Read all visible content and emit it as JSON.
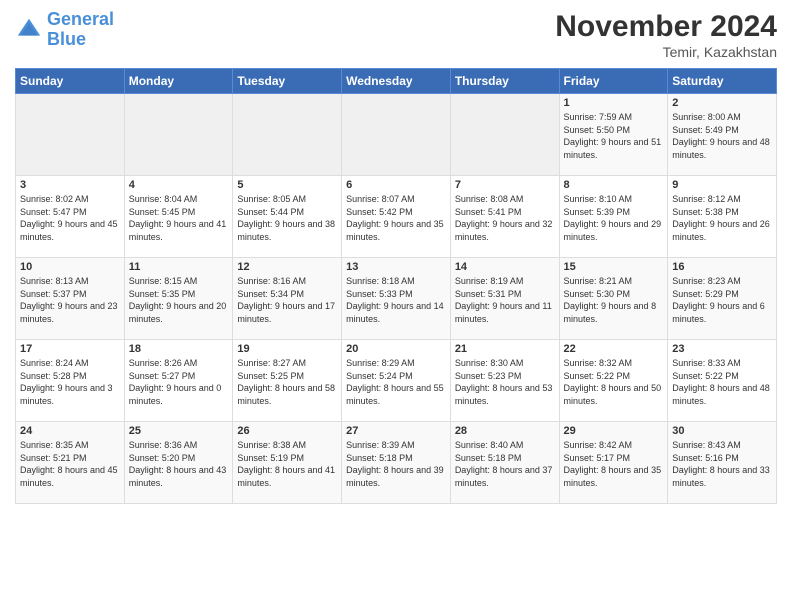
{
  "header": {
    "logo_line1": "General",
    "logo_line2": "Blue",
    "main_title": "November 2024",
    "subtitle": "Temir, Kazakhstan"
  },
  "days_of_week": [
    "Sunday",
    "Monday",
    "Tuesday",
    "Wednesday",
    "Thursday",
    "Friday",
    "Saturday"
  ],
  "weeks": [
    [
      {
        "day": "",
        "info": ""
      },
      {
        "day": "",
        "info": ""
      },
      {
        "day": "",
        "info": ""
      },
      {
        "day": "",
        "info": ""
      },
      {
        "day": "",
        "info": ""
      },
      {
        "day": "1",
        "info": "Sunrise: 7:59 AM\nSunset: 5:50 PM\nDaylight: 9 hours and 51 minutes."
      },
      {
        "day": "2",
        "info": "Sunrise: 8:00 AM\nSunset: 5:49 PM\nDaylight: 9 hours and 48 minutes."
      }
    ],
    [
      {
        "day": "3",
        "info": "Sunrise: 8:02 AM\nSunset: 5:47 PM\nDaylight: 9 hours and 45 minutes."
      },
      {
        "day": "4",
        "info": "Sunrise: 8:04 AM\nSunset: 5:45 PM\nDaylight: 9 hours and 41 minutes."
      },
      {
        "day": "5",
        "info": "Sunrise: 8:05 AM\nSunset: 5:44 PM\nDaylight: 9 hours and 38 minutes."
      },
      {
        "day": "6",
        "info": "Sunrise: 8:07 AM\nSunset: 5:42 PM\nDaylight: 9 hours and 35 minutes."
      },
      {
        "day": "7",
        "info": "Sunrise: 8:08 AM\nSunset: 5:41 PM\nDaylight: 9 hours and 32 minutes."
      },
      {
        "day": "8",
        "info": "Sunrise: 8:10 AM\nSunset: 5:39 PM\nDaylight: 9 hours and 29 minutes."
      },
      {
        "day": "9",
        "info": "Sunrise: 8:12 AM\nSunset: 5:38 PM\nDaylight: 9 hours and 26 minutes."
      }
    ],
    [
      {
        "day": "10",
        "info": "Sunrise: 8:13 AM\nSunset: 5:37 PM\nDaylight: 9 hours and 23 minutes."
      },
      {
        "day": "11",
        "info": "Sunrise: 8:15 AM\nSunset: 5:35 PM\nDaylight: 9 hours and 20 minutes."
      },
      {
        "day": "12",
        "info": "Sunrise: 8:16 AM\nSunset: 5:34 PM\nDaylight: 9 hours and 17 minutes."
      },
      {
        "day": "13",
        "info": "Sunrise: 8:18 AM\nSunset: 5:33 PM\nDaylight: 9 hours and 14 minutes."
      },
      {
        "day": "14",
        "info": "Sunrise: 8:19 AM\nSunset: 5:31 PM\nDaylight: 9 hours and 11 minutes."
      },
      {
        "day": "15",
        "info": "Sunrise: 8:21 AM\nSunset: 5:30 PM\nDaylight: 9 hours and 8 minutes."
      },
      {
        "day": "16",
        "info": "Sunrise: 8:23 AM\nSunset: 5:29 PM\nDaylight: 9 hours and 6 minutes."
      }
    ],
    [
      {
        "day": "17",
        "info": "Sunrise: 8:24 AM\nSunset: 5:28 PM\nDaylight: 9 hours and 3 minutes."
      },
      {
        "day": "18",
        "info": "Sunrise: 8:26 AM\nSunset: 5:27 PM\nDaylight: 9 hours and 0 minutes."
      },
      {
        "day": "19",
        "info": "Sunrise: 8:27 AM\nSunset: 5:25 PM\nDaylight: 8 hours and 58 minutes."
      },
      {
        "day": "20",
        "info": "Sunrise: 8:29 AM\nSunset: 5:24 PM\nDaylight: 8 hours and 55 minutes."
      },
      {
        "day": "21",
        "info": "Sunrise: 8:30 AM\nSunset: 5:23 PM\nDaylight: 8 hours and 53 minutes."
      },
      {
        "day": "22",
        "info": "Sunrise: 8:32 AM\nSunset: 5:22 PM\nDaylight: 8 hours and 50 minutes."
      },
      {
        "day": "23",
        "info": "Sunrise: 8:33 AM\nSunset: 5:22 PM\nDaylight: 8 hours and 48 minutes."
      }
    ],
    [
      {
        "day": "24",
        "info": "Sunrise: 8:35 AM\nSunset: 5:21 PM\nDaylight: 8 hours and 45 minutes."
      },
      {
        "day": "25",
        "info": "Sunrise: 8:36 AM\nSunset: 5:20 PM\nDaylight: 8 hours and 43 minutes."
      },
      {
        "day": "26",
        "info": "Sunrise: 8:38 AM\nSunset: 5:19 PM\nDaylight: 8 hours and 41 minutes."
      },
      {
        "day": "27",
        "info": "Sunrise: 8:39 AM\nSunset: 5:18 PM\nDaylight: 8 hours and 39 minutes."
      },
      {
        "day": "28",
        "info": "Sunrise: 8:40 AM\nSunset: 5:18 PM\nDaylight: 8 hours and 37 minutes."
      },
      {
        "day": "29",
        "info": "Sunrise: 8:42 AM\nSunset: 5:17 PM\nDaylight: 8 hours and 35 minutes."
      },
      {
        "day": "30",
        "info": "Sunrise: 8:43 AM\nSunset: 5:16 PM\nDaylight: 8 hours and 33 minutes."
      }
    ]
  ]
}
